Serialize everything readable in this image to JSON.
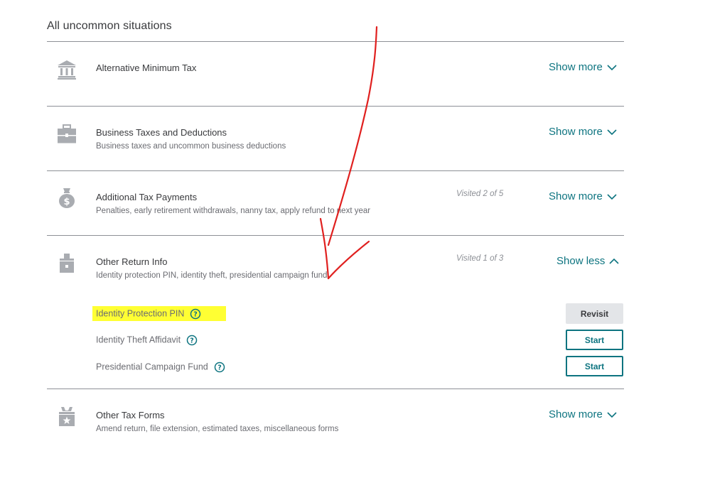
{
  "heading": "All uncommon situations",
  "sections": [
    {
      "title": "Alternative Minimum Tax",
      "description": "",
      "visited": "",
      "toggle": "Show more",
      "icon": "bank-icon"
    },
    {
      "title": "Business Taxes and Deductions",
      "description": "Business taxes and uncommon business deductions",
      "visited": "",
      "toggle": "Show more",
      "icon": "briefcase-icon"
    },
    {
      "title": "Additional Tax Payments",
      "description": "Penalties, early retirement withdrawals, nanny tax, apply refund to next year",
      "visited": "Visited 2 of 5",
      "toggle": "Show more",
      "icon": "money-bag-icon"
    },
    {
      "title": "Other Return Info",
      "description": "Identity protection PIN, identity theft, presidential campaign fund",
      "visited": "Visited 1 of 3",
      "toggle": "Show less",
      "icon": "ballot-box-icon"
    },
    {
      "title": "Other Tax Forms",
      "description": "Amend return, file extension, estimated taxes, miscellaneous forms",
      "visited": "",
      "toggle": "Show more",
      "icon": "star-box-icon"
    }
  ],
  "subitems": [
    {
      "label": "Identity Protection PIN",
      "button": "Revisit",
      "highlighted": true
    },
    {
      "label": "Identity Theft Affidavit",
      "button": "Start"
    },
    {
      "label": "Presidential Campaign Fund",
      "button": "Start"
    }
  ],
  "colors": {
    "accent": "#0d7480",
    "highlight": "#ffff33",
    "annotation": "#e0201f",
    "text": "#393a3d",
    "muted": "#6b6c72"
  }
}
